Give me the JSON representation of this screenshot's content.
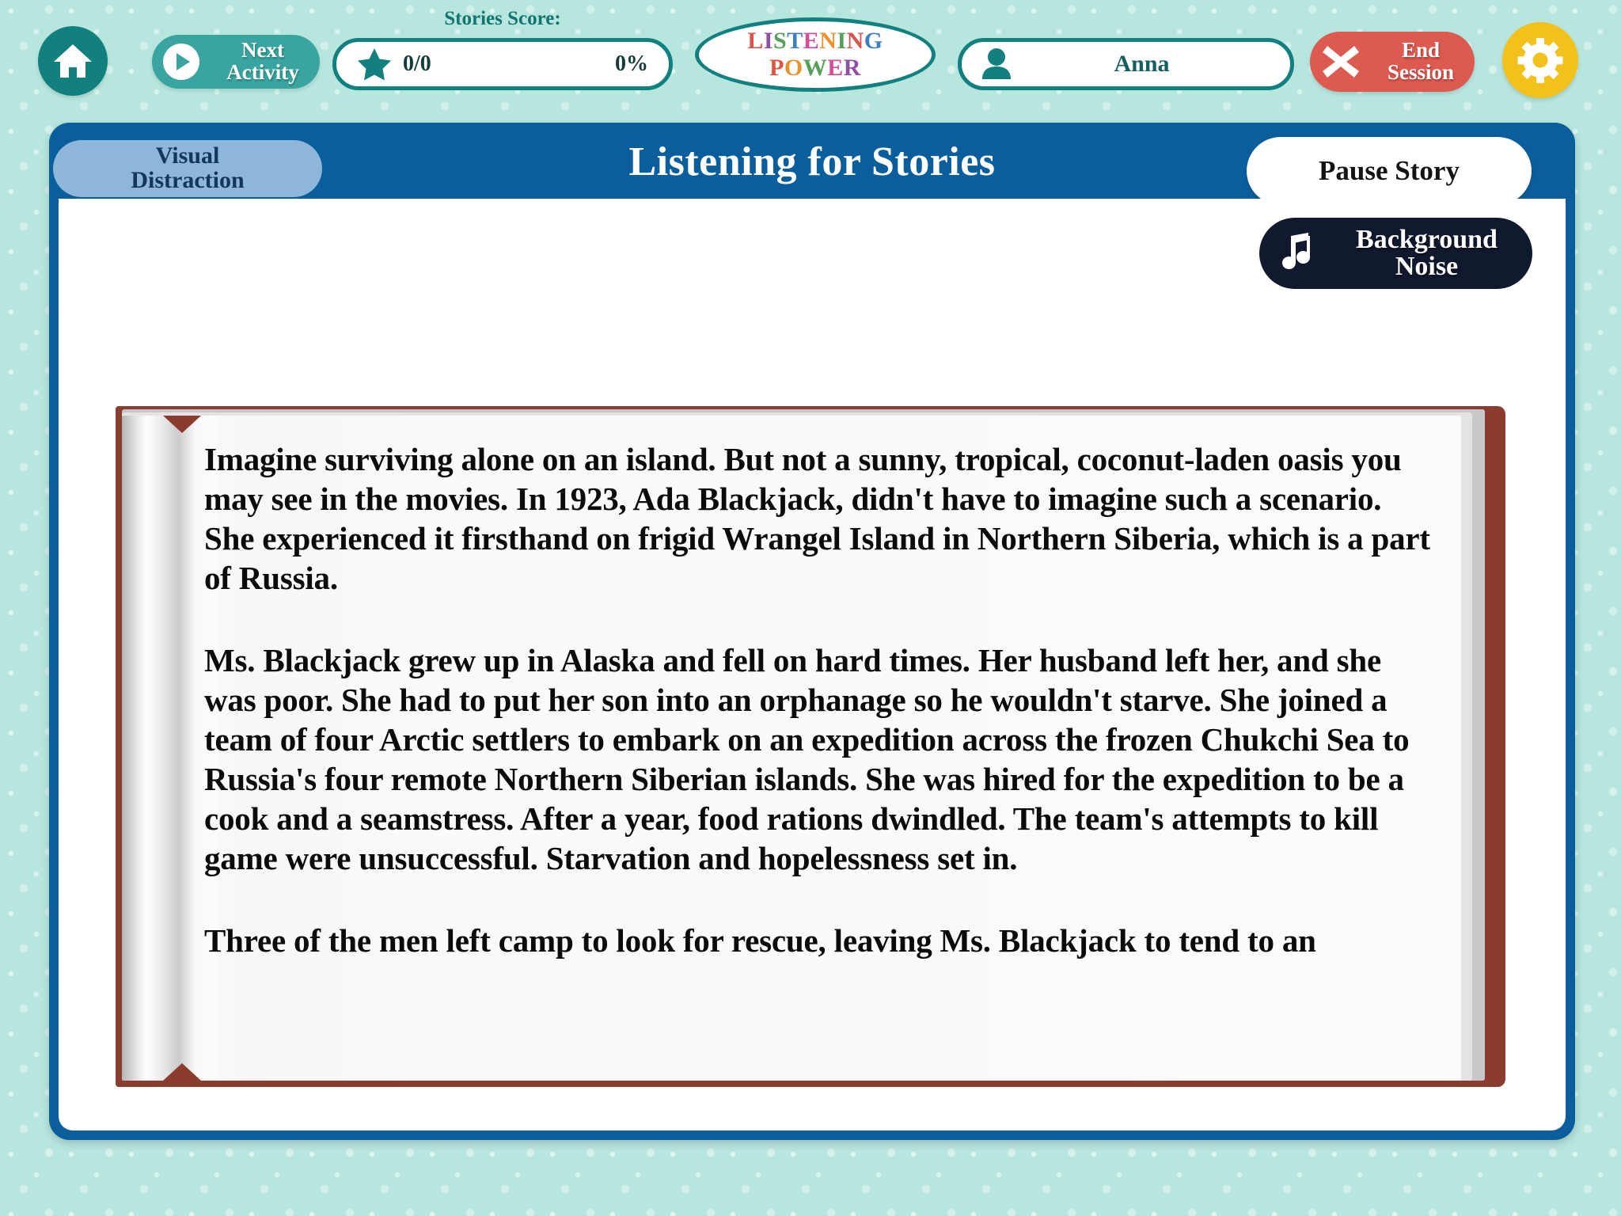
{
  "app": {
    "logo_line1": "LISTENING",
    "logo_line2": "POWER",
    "logo_colors_line1": [
      "#d9534f",
      "#8e4fa8",
      "#57a05a",
      "#3f7fc1",
      "#d14f9b",
      "#e8922e",
      "#57a05a",
      "#d9534f",
      "#3f7fc1"
    ],
    "logo_colors_line2": [
      "#e0553f",
      "#e8922e",
      "#57a05a",
      "#d14f9b",
      "#8e4fa8",
      "#3f7fc1"
    ],
    "background_color": "#b6e6de",
    "accent_teal": "#12807f",
    "accent_blue": "#0b5e9c",
    "danger_red": "#dd5a50",
    "gear_yellow": "#f3c11c"
  },
  "topbar": {
    "home_icon": "home-icon",
    "next_activity": {
      "line1": "Next",
      "line2": "Activity",
      "icon": "play-icon"
    },
    "score": {
      "label": "Stories Score:",
      "icon": "star-icon",
      "fraction": "0/0",
      "percent": "0%"
    },
    "user": {
      "icon": "person-icon",
      "name": "Anna"
    },
    "end_session": {
      "icon": "close-x-icon",
      "line1": "End",
      "line2": "Session"
    },
    "settings_icon": "gear-icon"
  },
  "panel": {
    "visual_distraction": {
      "line1": "Visual",
      "line2": "Distraction"
    },
    "title": "Listening for Stories",
    "pause_story": "Pause Story",
    "background_noise": {
      "icon": "music-note-icon",
      "line1": "Background",
      "line2": "Noise"
    }
  },
  "story": {
    "paragraphs": [
      "Imagine surviving alone on an island. But not a sunny, tropical, coconut-laden oasis you may see in the movies. In 1923, Ada Blackjack, didn't have to imagine such a scenario. She experienced it firsthand on frigid Wrangel Island in Northern Siberia, which is a part of Russia.",
      "Ms. Blackjack grew up in Alaska and fell on hard times. Her husband left her, and she was poor. She had to put her son into an orphanage so he wouldn't starve. She joined a team of four Arctic settlers to embark on an expedition across the frozen Chukchi Sea to Russia's four remote Northern Siberian islands. She was hired for the expedition to be a cook and a seamstress. After a year, food rations dwindled. The team's attempts to kill game were unsuccessful. Starvation and hopelessness set in.",
      "Three of the men left camp to look for rescue, leaving Ms. Blackjack to tend to an"
    ]
  }
}
